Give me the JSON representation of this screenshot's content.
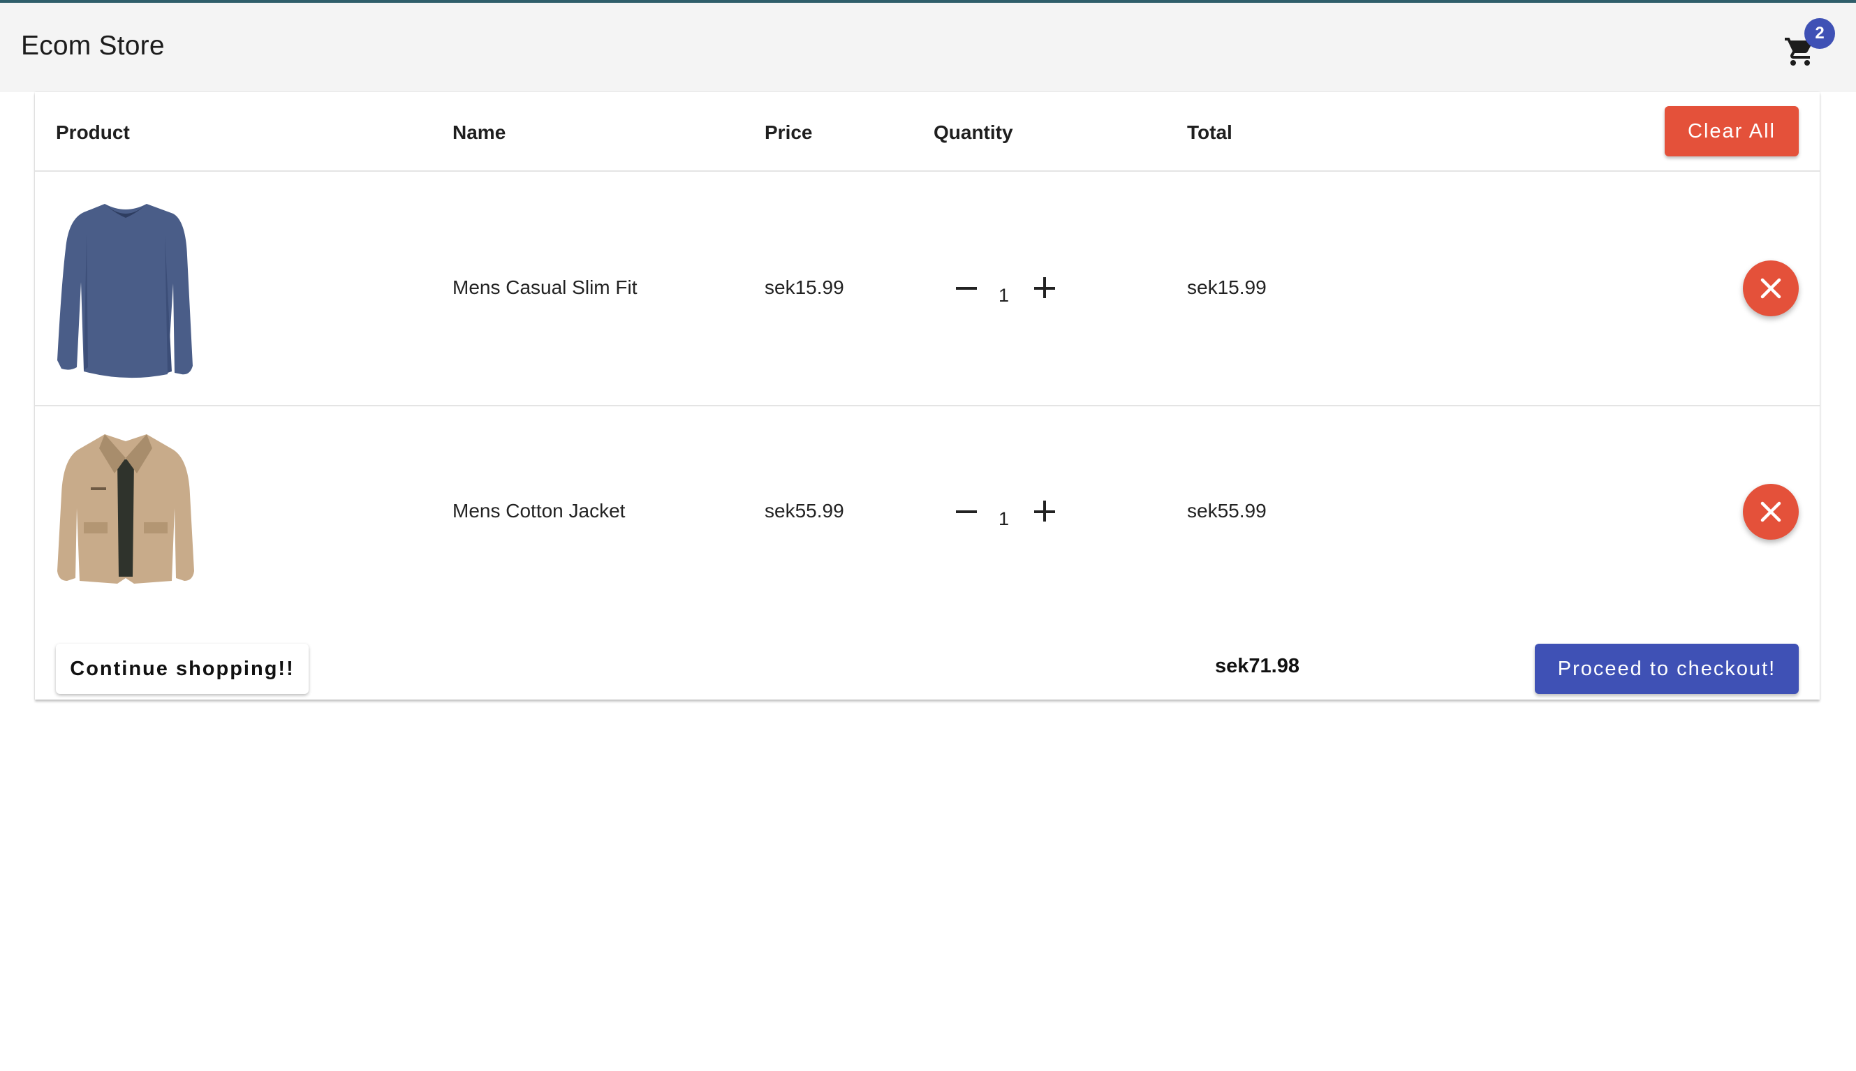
{
  "app": {
    "title": "Ecom Store"
  },
  "cart": {
    "badge_count": "2",
    "icon": "shopping-cart-icon"
  },
  "table": {
    "headers": {
      "product": "Product",
      "name": "Name",
      "price": "Price",
      "quantity": "Quantity",
      "total": "Total"
    },
    "clear_all_label": "Clear All"
  },
  "items": [
    {
      "name": "Mens Casual Slim Fit",
      "price": "sek15.99",
      "quantity": "1",
      "total": "sek15.99",
      "image": "blue-long-sleeve-shirt"
    },
    {
      "name": "Mens Cotton Jacket",
      "price": "sek55.99",
      "quantity": "1",
      "total": "sek55.99",
      "image": "beige-cotton-jacket"
    }
  ],
  "footer": {
    "continue_label": "Continue shopping!!",
    "grand_total": "sek71.98",
    "checkout_label": "Proceed to checkout!"
  },
  "colors": {
    "accent_red": "#e4513a",
    "primary_blue": "#3f51b5",
    "appbar_bg": "#f4f4f4"
  }
}
